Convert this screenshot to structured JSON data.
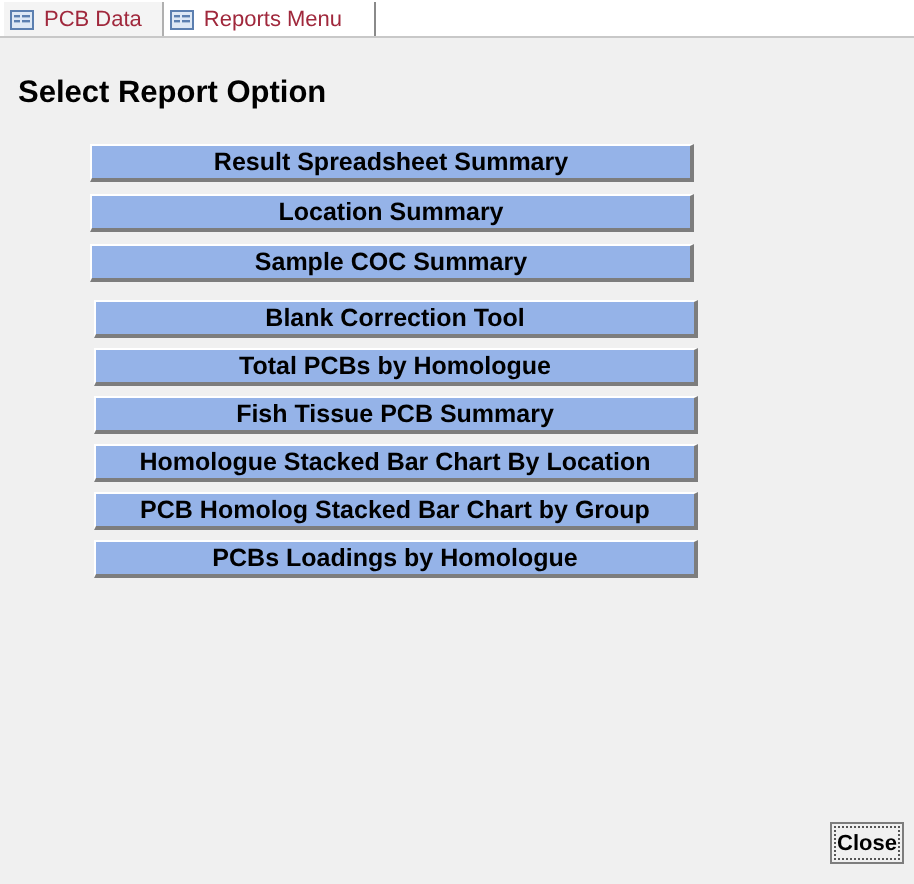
{
  "tabs": [
    {
      "label": "PCB Data",
      "selected": false
    },
    {
      "label": "Reports Menu",
      "selected": true
    }
  ],
  "form": {
    "title": "Select Report Option",
    "button_groups": [
      [
        "Result Spreadsheet Summary",
        "Location Summary",
        "Sample COC Summary"
      ],
      [
        "Blank Correction Tool",
        "Total PCBs by Homologue",
        "Fish Tissue PCB Summary",
        "Homologue Stacked Bar Chart By Location",
        "PCB Homolog Stacked Bar Chart by Group",
        "PCBs Loadings by Homologue"
      ]
    ],
    "close_button": "Close"
  }
}
